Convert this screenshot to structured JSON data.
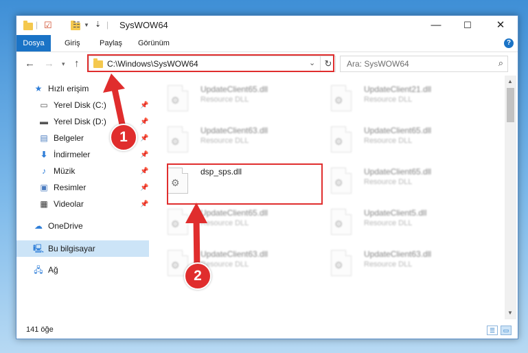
{
  "window": {
    "title": "SysWOW64"
  },
  "ribbon": {
    "tabs": [
      "Dosya",
      "Giriş",
      "Paylaş",
      "Görünüm"
    ],
    "help": "?"
  },
  "address": {
    "path": "C:\\Windows\\SysWOW64"
  },
  "search": {
    "placeholder": "Ara: SysWOW64"
  },
  "sidebar": {
    "quick_access": "Hızlı erişim",
    "items": [
      {
        "label": "Yerel Disk (C:)",
        "icon": "drive-icon"
      },
      {
        "label": "Yerel Disk (D:)",
        "icon": "drive-icon"
      },
      {
        "label": "Belgeler",
        "icon": "documents-icon"
      },
      {
        "label": "İndirmeler",
        "icon": "downloads-icon"
      },
      {
        "label": "Müzik",
        "icon": "music-icon"
      },
      {
        "label": "Resimler",
        "icon": "pictures-icon"
      },
      {
        "label": "Videolar",
        "icon": "videos-icon"
      }
    ],
    "onedrive": "OneDrive",
    "this_pc": "Bu bilgisayar",
    "network": "Ağ"
  },
  "files": [
    {
      "name": "UpdateClient65.dll",
      "type": "Resource DLL",
      "blurred": true
    },
    {
      "name": "UpdateClient21.dll",
      "type": "Resource DLL",
      "blurred": true
    },
    {
      "name": "UpdateClient63.dll",
      "type": "Resource DLL",
      "blurred": true
    },
    {
      "name": "UpdateClient65.dll",
      "type": "Resource DLL",
      "blurred": true
    },
    {
      "name": "dsp_sps.dll",
      "type": "",
      "blurred": false
    },
    {
      "name": "UpdateClient65.dll",
      "type": "Resource DLL",
      "blurred": true
    },
    {
      "name": "UpdateClient65.dll",
      "type": "Resource DLL",
      "blurred": true
    },
    {
      "name": "UpdateClient5.dll",
      "type": "Resource DLL",
      "blurred": true
    },
    {
      "name": "UpdateClient63.dll",
      "type": "Resource DLL",
      "blurred": true
    },
    {
      "name": "UpdateClient63.dll",
      "type": "Resource DLL",
      "blurred": true
    }
  ],
  "status": {
    "item_count": "141 öğe"
  },
  "annotations": {
    "step1": "1",
    "step2": "2",
    "color": "#e02d2d"
  },
  "colors": {
    "accent": "#1a73c6",
    "selection": "#cce4f7"
  }
}
